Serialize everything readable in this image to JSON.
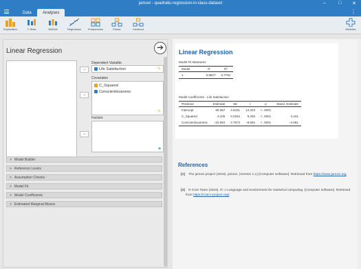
{
  "window": {
    "title": "jamovi - quadratic-regression-in-class-dataset",
    "minimize": "–",
    "maximize": "□",
    "close": "✕"
  },
  "menu": {
    "data_tab": "Data",
    "analyses_tab": "Analyses",
    "more": "⋮"
  },
  "toolbar": {
    "items": [
      {
        "label": "Exploration",
        "icon": "bar-chart-icon"
      },
      {
        "label": "T-Tests",
        "icon": "t-tests-icon"
      },
      {
        "label": "ANOVA",
        "icon": "anova-icon"
      },
      {
        "label": "Regression",
        "icon": "regression-icon"
      },
      {
        "label": "Frequencies",
        "icon": "frequencies-icon"
      },
      {
        "label": "Factor",
        "icon": "factor-icon"
      },
      {
        "label": "medmod",
        "icon": "medmod-icon"
      }
    ],
    "modules": {
      "label": "Modules",
      "icon": "plus-icon"
    }
  },
  "options": {
    "title": "Linear Regression",
    "dependent": {
      "label": "Dependent Variable",
      "value": "Life Satisfaction"
    },
    "covariates": {
      "label": "Covariates",
      "items": [
        "C_Squared",
        "Conscientiousness"
      ]
    },
    "factors": {
      "label": "Factors"
    },
    "sections": [
      "Model Builder",
      "Reference Levels",
      "Assumption Checks",
      "Model Fit",
      "Model Coefficients",
      "Estimated Marginal Means"
    ]
  },
  "results": {
    "title": "Linear Regression",
    "fit": {
      "caption": "Model Fit Measures",
      "headers": [
        "Model",
        "R",
        "R²"
      ],
      "rows": [
        [
          "1",
          "0.8827",
          "0.7791"
        ]
      ]
    },
    "coef": {
      "caption": "Model Coefficients - Life Satisfaction",
      "headers": [
        "Predictor",
        "Estimate",
        "SE",
        "t",
        "p",
        "Stand. Estimate"
      ],
      "rows": [
        [
          "Intercept",
          "69.367",
          "4.8431",
          "14.323",
          "< .0001",
          ""
        ],
        [
          "C_Squared",
          "3.106",
          "0.3342",
          "9.293",
          "< .0001",
          "4.441"
        ],
        [
          "Conscientiousness",
          "−23.064",
          "2.7873",
          "−8.592",
          "< .0001",
          "−4.091"
        ]
      ]
    }
  },
  "references": {
    "title": "References",
    "items": [
      {
        "num": "[1]",
        "pre": "The jamovi project (2019).",
        "it": "jamovi",
        "post": ". (Version 1.1) [Computer Software]. Retrieved from",
        "link": "https://www.jamovi.org",
        "end": "."
      },
      {
        "num": "[2]",
        "pre": "R Core Team (2018).",
        "it": "R: A Language and environment for statistical computing",
        "post": ". [Computer software]. Retrieved from",
        "link": "https://cran.r-project.org/",
        "end": "."
      }
    ]
  },
  "colors": {
    "accent": "#2f7dc4",
    "heading": "#2262a5",
    "pencil": "#f0a020"
  }
}
